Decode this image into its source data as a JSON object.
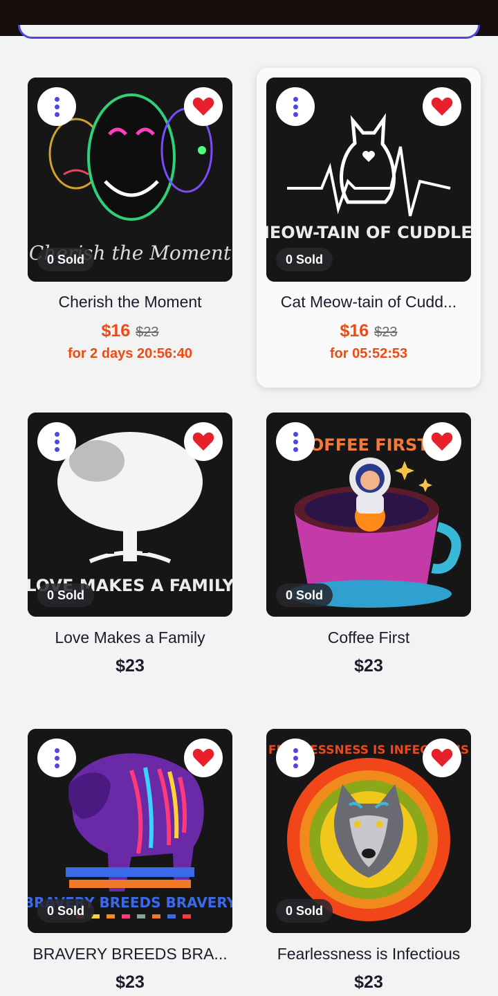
{
  "colors": {
    "accent": "#4f46e5",
    "sale": "#f04a14",
    "heart": "#e8202b"
  },
  "products": [
    {
      "title": "Cherish the Moment",
      "sold": "0 Sold",
      "price": "$16",
      "old_price": "$23",
      "countdown": "for 2 days 20:56:40",
      "image_text": "Cherish the Moment",
      "image_icon": "three-faces-art"
    },
    {
      "title": "Cat Meow-tain of Cudd...",
      "sold": "0 Sold",
      "price": "$16",
      "old_price": "$23",
      "countdown": "for 05:52:53",
      "image_text": "MEOW-TAIN OF CUDDLES",
      "image_icon": "cat-heartbeat-art"
    },
    {
      "title": "Love Makes a Family",
      "sold": "0 Sold",
      "price": "$23",
      "image_text": "LOVE MAKES A FAMILY",
      "image_icon": "family-tree-art"
    },
    {
      "title": "Coffee First",
      "sold": "0 Sold",
      "price": "$23",
      "image_text": "COFFEE FIRST",
      "image_icon": "astronaut-coffee-art"
    },
    {
      "title": "BRAVERY BREEDS BRA...",
      "sold": "0 Sold",
      "price": "$23",
      "image_text": "BRAVERY BREEDS BRAVERY",
      "image_icon": "panther-art"
    },
    {
      "title": "Fearlessness is Infectious",
      "sold": "0 Sold",
      "price": "$23",
      "image_text": "FEARLESSNESS IS INFECTIOUS",
      "image_icon": "wolf-art"
    }
  ]
}
